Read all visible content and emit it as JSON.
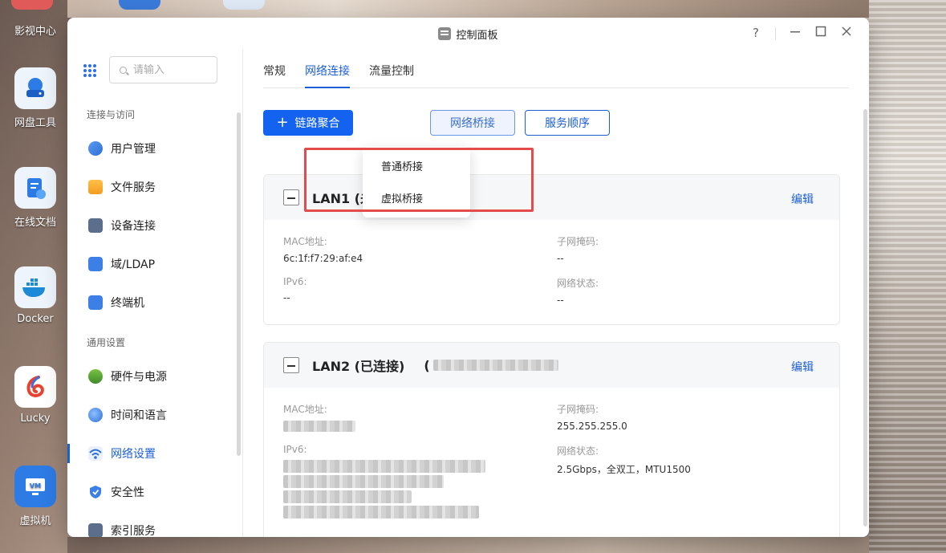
{
  "desktop": {
    "icons": [
      {
        "label": "影视中心"
      },
      {
        "label": "网盘工具"
      },
      {
        "label": "在线文档"
      },
      {
        "label": "Docker"
      },
      {
        "label": "Lucky"
      },
      {
        "label": "虚拟机",
        "badge": "VM"
      }
    ]
  },
  "window": {
    "title": "控制面板",
    "help": "?"
  },
  "sidebar": {
    "search_placeholder": "请输入",
    "sections": [
      {
        "label": "连接与访问"
      },
      {
        "label": "通用设置"
      }
    ],
    "items": [
      {
        "label": "用户管理"
      },
      {
        "label": "文件服务"
      },
      {
        "label": "设备连接"
      },
      {
        "label": "域/LDAP"
      },
      {
        "label": "终端机"
      },
      {
        "label": "硬件与电源"
      },
      {
        "label": "时间和语言"
      },
      {
        "label": "网络设置"
      },
      {
        "label": "安全性"
      },
      {
        "label": "索引服务"
      }
    ],
    "active": "网络设置"
  },
  "tabs": [
    {
      "label": "常规"
    },
    {
      "label": "网络连接"
    },
    {
      "label": "流量控制"
    }
  ],
  "toolbar": {
    "link_aggregation": "链路聚合",
    "network_bridge": "网络桥接",
    "service_order": "服务顺序"
  },
  "dropdown": {
    "items": [
      {
        "label": "普通桥接"
      },
      {
        "label": "虚拟桥接"
      }
    ]
  },
  "lan1": {
    "title": "LAN1 (未",
    "edit": "编辑",
    "mac_label": "MAC地址:",
    "mac_value": "6c:1f:f7:29:af:e4",
    "subnet_label": "子网掩码:",
    "subnet_value": "--",
    "ipv6_label": "IPv6:",
    "ipv6_value": "--",
    "status_label": "网络状态:",
    "status_value": "--"
  },
  "lan2": {
    "title": "LAN2 (已连接)",
    "paren": "(",
    "edit": "编辑",
    "mac_label": "MAC地址:",
    "subnet_label": "子网掩码:",
    "subnet_value": "255.255.255.0",
    "ipv6_label": "IPv6:",
    "status_label": "网络状态:",
    "status_value": "2.5Gbps，全双工，MTU1500"
  },
  "colors": {
    "accent": "#1463f0",
    "link": "#1c5fd4",
    "highlight": "#e44c4c"
  }
}
